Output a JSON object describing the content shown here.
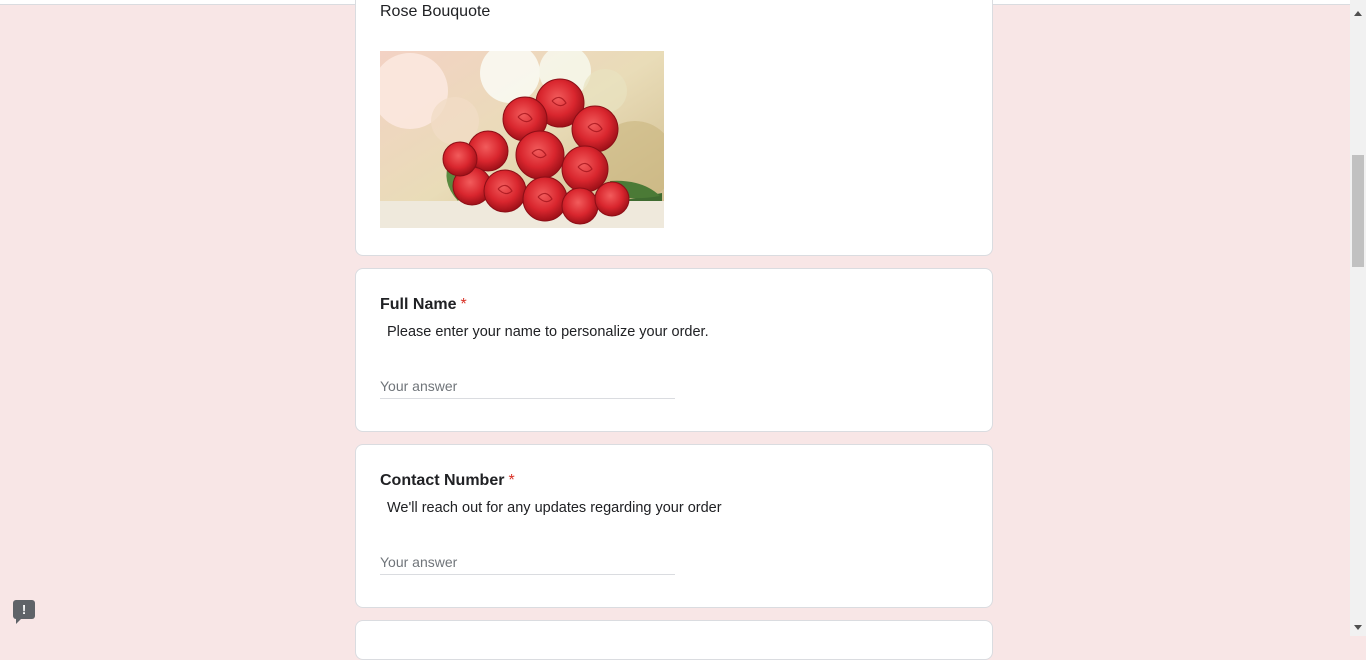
{
  "image_section": {
    "title": "Rose Bouquote"
  },
  "questions": [
    {
      "title": "Full Name",
      "required_marker": "*",
      "description": "Please enter your name to personalize your order.",
      "placeholder": "Your answer",
      "value": ""
    },
    {
      "title": "Contact Number",
      "required_marker": "*",
      "description": "We'll reach out for any updates regarding your order",
      "placeholder": "Your answer",
      "value": ""
    }
  ],
  "feedback": {
    "icon": "report-icon",
    "glyph": "!"
  },
  "colors": {
    "page_background": "#f8e6e6",
    "card": "#ffffff",
    "required": "#d93025",
    "text": "#202124"
  }
}
